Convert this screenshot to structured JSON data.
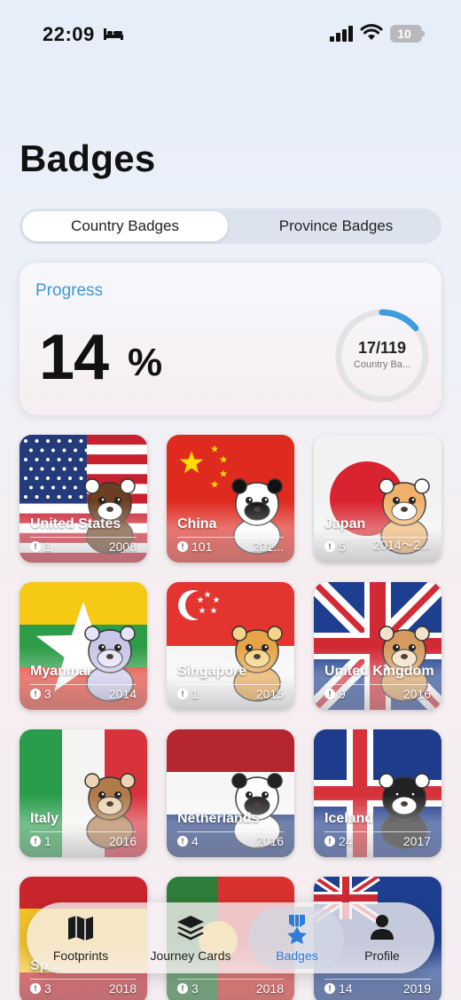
{
  "status": {
    "time": "22:09",
    "battery": "10"
  },
  "page": {
    "title": "Badges"
  },
  "segments": [
    {
      "label": "Country Badges",
      "active": true
    },
    {
      "label": "Province Badges",
      "active": false
    }
  ],
  "progress": {
    "label": "Progress",
    "percent": "14",
    "percent_sign": "%",
    "count": "17/119",
    "sublabel": "Country Ba...",
    "fraction": 0.14,
    "ring_color": "#3d9be0"
  },
  "badges": [
    {
      "name": "United States",
      "count": "1",
      "year": "2008",
      "flag": "us",
      "mascot": "eagle"
    },
    {
      "name": "China",
      "count": "101",
      "year": "201...",
      "flag": "cn",
      "mascot": "panda"
    },
    {
      "name": "Japan",
      "count": "5",
      "year": "2014～2...",
      "flag": "jp",
      "mascot": "cat"
    },
    {
      "name": "Myanmar",
      "count": "3",
      "year": "2014",
      "flag": "mm",
      "mascot": "elephant"
    },
    {
      "name": "Singapore",
      "count": "1",
      "year": "2015",
      "flag": "sg",
      "mascot": "lion"
    },
    {
      "name": "United Kingdom",
      "count": "9",
      "year": "2016",
      "flag": "uk",
      "mascot": "bulldog"
    },
    {
      "name": "Italy",
      "count": "1",
      "year": "2016",
      "flag": "it",
      "mascot": "wolf"
    },
    {
      "name": "Netherlands",
      "count": "4",
      "year": "2016",
      "flag": "nl",
      "mascot": "cow"
    },
    {
      "name": "Iceland",
      "count": "24",
      "year": "2017",
      "flag": "is",
      "mascot": "puffin"
    },
    {
      "name": "Sp...",
      "count": "3",
      "year": "2018",
      "flag": "es",
      "mascot": ""
    },
    {
      "name": "",
      "count": "3",
      "year": "2018",
      "flag": "pt",
      "mascot": ""
    },
    {
      "name": "",
      "count": "14",
      "year": "2019",
      "flag": "au",
      "mascot": ""
    }
  ],
  "tabbar": [
    {
      "label": "Footprints",
      "icon": "map-icon",
      "active": false
    },
    {
      "label": "Journey Cards",
      "icon": "stack-icon",
      "active": false
    },
    {
      "label": "Badges",
      "icon": "medal-icon",
      "active": true
    },
    {
      "label": "Profile",
      "icon": "person-icon",
      "active": false
    }
  ]
}
